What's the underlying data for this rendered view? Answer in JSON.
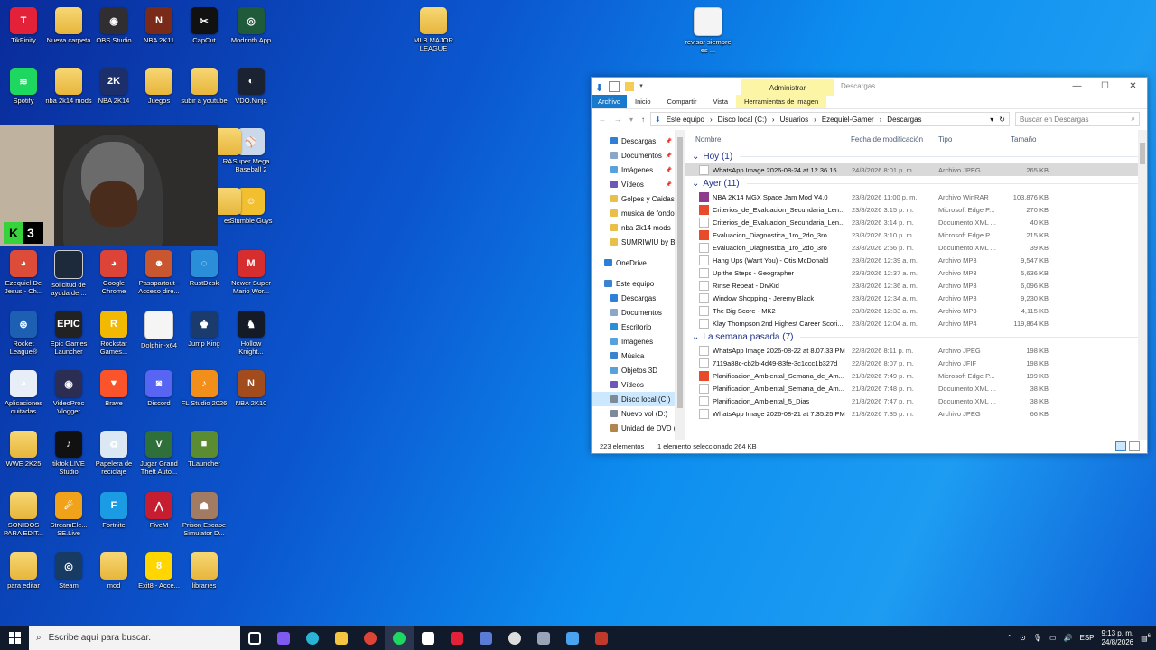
{
  "desktop": {
    "icons": [
      {
        "label": "TikFinity",
        "color": "#e3223a",
        "glyph": "T"
      },
      {
        "label": "Nueva carpeta",
        "color": "folder",
        "glyph": ""
      },
      {
        "label": "OBS Studio",
        "color": "#302e31",
        "glyph": "◉"
      },
      {
        "label": "NBA 2K11",
        "color": "#7a2a18",
        "glyph": "N"
      },
      {
        "label": "CapCut",
        "color": "#111111",
        "glyph": "✂"
      },
      {
        "label": "Modrinth App",
        "color": "#1f5a3a",
        "glyph": "◎"
      },
      {
        "label": "MLB MAJOR LEAGUE",
        "color": "folder",
        "glyph": ""
      },
      {
        "label": "revisar siempre es ...",
        "color": "#f4f4f4",
        "glyph": ""
      },
      {
        "label": "Spotify",
        "color": "#1ed760",
        "glyph": "≋"
      },
      {
        "label": "nba 2k14 mods",
        "color": "folder",
        "glyph": ""
      },
      {
        "label": "NBA 2K14",
        "color": "#1d2f6b",
        "glyph": "2K"
      },
      {
        "label": "Juegos",
        "color": "folder",
        "glyph": ""
      },
      {
        "label": "subir a youtube",
        "color": "folder",
        "glyph": ""
      },
      {
        "label": "VDO.Ninja",
        "color": "#1b2333",
        "glyph": "◐"
      },
      {
        "label": "Super Mega Baseball 2",
        "color": "#c9d8ea",
        "glyph": "⚾"
      },
      {
        "label": "Stumble Guys",
        "color": "#f2c02f",
        "glyph": "☺"
      },
      {
        "label": "Ezequiel De Jesus - Ch...",
        "color": "#dd4b39",
        "glyph": "◕"
      },
      {
        "label": "solicitud de ayuda de ...",
        "color": "#1d2a3c",
        "glyph": ""
      },
      {
        "label": "Google Chrome",
        "color": "#db4437",
        "glyph": "◕"
      },
      {
        "label": "Passpartout - Acceso dire...",
        "color": "#c9562e",
        "glyph": "☻"
      },
      {
        "label": "RustDesk",
        "color": "#2a8ed9",
        "glyph": "◌"
      },
      {
        "label": "Newer Super Mario Wor...",
        "color": "#d62e2e",
        "glyph": "M"
      },
      {
        "label": "Rocket League®",
        "color": "#1c5fb3",
        "glyph": "⊛"
      },
      {
        "label": "Epic Games Launcher",
        "color": "#222222",
        "glyph": "EPIC"
      },
      {
        "label": "Rockstar Games...",
        "color": "#f2b900",
        "glyph": "R"
      },
      {
        "label": "Dolphin-x64",
        "color": "#f5f5f5",
        "glyph": ""
      },
      {
        "label": "Jump King",
        "color": "#1a3b6b",
        "glyph": "♚"
      },
      {
        "label": "Hollow Knight...",
        "color": "#141a26",
        "glyph": "♞"
      },
      {
        "label": "Aplicaciones quitadas",
        "color": "#e8eef7",
        "glyph": "◕"
      },
      {
        "label": "VideoProc Vlogger",
        "color": "#2b2e52",
        "glyph": "◉"
      },
      {
        "label": "Brave",
        "color": "#fb542b",
        "glyph": "▼"
      },
      {
        "label": "Discord",
        "color": "#5865f2",
        "glyph": "◙"
      },
      {
        "label": "FL Studio 2026",
        "color": "#f28f1a",
        "glyph": "♪"
      },
      {
        "label": "NBA 2K10",
        "color": "#a24b1d",
        "glyph": "N"
      },
      {
        "label": "WWE 2K25",
        "color": "folder",
        "glyph": ""
      },
      {
        "label": "tiktok LIVE Studio",
        "color": "#111111",
        "glyph": "♪"
      },
      {
        "label": "Papelera de reciclaje",
        "color": "#dbe8f4",
        "glyph": "♻"
      },
      {
        "label": "Jugar Grand Theft Auto...",
        "color": "#2f6f3a",
        "glyph": "V"
      },
      {
        "label": "TLauncher",
        "color": "#5b8c32",
        "glyph": "■"
      },
      {
        "label": "SONIDOS PARA EDIT...",
        "color": "folder",
        "glyph": ""
      },
      {
        "label": "StreamEle... SE.Live",
        "color": "#f0a31a",
        "glyph": "☄"
      },
      {
        "label": "Fortnite",
        "color": "#1c9be5",
        "glyph": "F"
      },
      {
        "label": "FiveM",
        "color": "#c61d30",
        "glyph": "⋀"
      },
      {
        "label": "Prison Escape Simulator D...",
        "color": "#a27b63",
        "glyph": "☗"
      },
      {
        "label": "para editar",
        "color": "folder",
        "glyph": ""
      },
      {
        "label": "Steam",
        "color": "#173b62",
        "glyph": "◎"
      },
      {
        "label": "mod",
        "color": "folder",
        "glyph": ""
      },
      {
        "label": "Exit8 - Acce...",
        "color": "#ffd600",
        "glyph": "8"
      },
      {
        "label": "librarıes",
        "color": "folder",
        "glyph": ""
      },
      {
        "label": "RA",
        "color": "folder",
        "glyph": ""
      },
      {
        "label": "es",
        "color": "folder",
        "glyph": ""
      }
    ],
    "webcam_badge": "3",
    "webcam_logo": "K"
  },
  "explorer": {
    "context_tab": "Administrar",
    "window_title": "Descargas",
    "ribbon_tabs": [
      "Archivo",
      "Inicio",
      "Compartir",
      "Vista",
      "Herramientas de imagen"
    ],
    "window_buttons": [
      "—",
      "☐",
      "✕"
    ],
    "path": [
      "Este equipo",
      "Disco local (C:)",
      "Usuarios",
      "Ezequiel-Gamer",
      "Descargas"
    ],
    "search_placeholder": "Buscar en Descargas",
    "nav": [
      {
        "label": "Descargas",
        "pin": "📌",
        "color": "#2f7fd9"
      },
      {
        "label": "Documentos",
        "pin": "📌",
        "color": "#8aa7c9"
      },
      {
        "label": "Imágenes",
        "pin": "📌",
        "color": "#5aa0d9"
      },
      {
        "label": "Vídeos",
        "pin": "📌",
        "color": "#6d58b8"
      },
      {
        "label": "Golpes y Caidas",
        "pin": "",
        "color": "#e8bf48"
      },
      {
        "label": "musica de fondo",
        "pin": "",
        "color": "#e8bf48"
      },
      {
        "label": "nba 2k14 mods",
        "pin": "",
        "color": "#e8bf48"
      },
      {
        "label": "SUMRIWIU by BI",
        "pin": "",
        "color": "#e8bf48"
      }
    ],
    "nav2": [
      {
        "label": "OneDrive",
        "color": "#2a7fd6"
      }
    ],
    "nav3": [
      {
        "label": "Este equipo",
        "color": "#3b83cf"
      },
      {
        "label": "Descargas",
        "color": "#2f7fd9"
      },
      {
        "label": "Documentos",
        "color": "#8aa7c9"
      },
      {
        "label": "Escritorio",
        "color": "#2a8ed9"
      },
      {
        "label": "Imágenes",
        "color": "#5aa0d9"
      },
      {
        "label": "Música",
        "color": "#3b83cf"
      },
      {
        "label": "Objetos 3D",
        "color": "#5aa0d9"
      },
      {
        "label": "Vídeos",
        "color": "#6d58b8"
      },
      {
        "label": "Disco local (C:)",
        "color": "#7c8a99"
      },
      {
        "label": "Nuevo vol (D:)",
        "color": "#7c8a99"
      },
      {
        "label": "Unidad de DVD (",
        "color": "#b0864c"
      }
    ],
    "columns": [
      "Nombre",
      "Fecha de modificación",
      "Tipo",
      "Tamaño"
    ],
    "groups": [
      {
        "title": "Hoy (1)",
        "rows": [
          {
            "name": "WhatsApp Image 2026-08-24 at 12.36.15 ...",
            "date": "24/8/2026 8:01 p. m.",
            "type": "Archivo JPEG",
            "size": "265 KB",
            "sel": true
          }
        ]
      },
      {
        "title": "Ayer (11)",
        "rows": [
          {
            "name": "NBA 2K14 MGX Space Jam Mod V4.0",
            "date": "23/8/2026 11:00 p. m.",
            "type": "Archivo WinRAR",
            "size": "103,876 KB"
          },
          {
            "name": "Criterios_de_Evaluacion_Secundaria_Len...",
            "date": "23/8/2026 3:15 p. m.",
            "type": "Microsoft Edge P...",
            "size": "270 KB"
          },
          {
            "name": "Criterios_de_Evaluacion_Secundaria_Len...",
            "date": "23/8/2026 3:14 p. m.",
            "type": "Documento XML ...",
            "size": "40 KB"
          },
          {
            "name": "Evaluacion_Diagnostica_1ro_2do_3ro",
            "date": "23/8/2026 3:10 p. m.",
            "type": "Microsoft Edge P...",
            "size": "215 KB"
          },
          {
            "name": "Evaluacion_Diagnostica_1ro_2do_3ro",
            "date": "23/8/2026 2:56 p. m.",
            "type": "Documento XML ...",
            "size": "39 KB"
          },
          {
            "name": "Hang Ups (Want You) - Otis McDonald",
            "date": "23/8/2026 12:39 a. m.",
            "type": "Archivo MP3",
            "size": "9,547 KB"
          },
          {
            "name": "Up the Steps - Geographer",
            "date": "23/8/2026 12:37 a. m.",
            "type": "Archivo MP3",
            "size": "5,636 KB"
          },
          {
            "name": "Rinse Repeat - DivKid",
            "date": "23/8/2026 12:36 a. m.",
            "type": "Archivo MP3",
            "size": "6,096 KB"
          },
          {
            "name": "Window Shopping - Jeremy Black",
            "date": "23/8/2026 12:34 a. m.",
            "type": "Archivo MP3",
            "size": "9,230 KB"
          },
          {
            "name": "The Big Score - MK2",
            "date": "23/8/2026 12:33 a. m.",
            "type": "Archivo MP3",
            "size": "4,115 KB"
          },
          {
            "name": "Klay Thompson 2nd Highest Career Scori...",
            "date": "23/8/2026 12:04 a. m.",
            "type": "Archivo MP4",
            "size": "119,864 KB"
          }
        ]
      },
      {
        "title": "La semana pasada (7)",
        "rows": [
          {
            "name": "WhatsApp Image 2026-08-22 at 8.07.33 PM",
            "date": "22/8/2026 8:11 p. m.",
            "type": "Archivo JPEG",
            "size": "198 KB"
          },
          {
            "name": "7119a88c-cb2b-4d49-83fe-3c1ccc1b327d",
            "date": "22/8/2026 8:07 p. m.",
            "type": "Archivo JFIF",
            "size": "198 KB"
          },
          {
            "name": "Planificacion_Ambiental_Semana_de_Am...",
            "date": "21/8/2026 7:49 p. m.",
            "type": "Microsoft Edge P...",
            "size": "199 KB"
          },
          {
            "name": "Planificacion_Ambiental_Semana_de_Am...",
            "date": "21/8/2026 7:48 p. m.",
            "type": "Documento XML ...",
            "size": "38 KB"
          },
          {
            "name": "Planificacion_Ambiental_5_Dias",
            "date": "21/8/2026 7:47 p. m.",
            "type": "Documento XML ...",
            "size": "38 KB"
          },
          {
            "name": "WhatsApp Image 2026-08-21 at 7.35.25 PM",
            "date": "21/8/2026 7:35 p. m.",
            "type": "Archivo JPEG",
            "size": "66 KB"
          }
        ]
      }
    ],
    "status_count": "223 elementos",
    "status_selected": "1 elemento seleccionado  264 KB"
  },
  "taskbar": {
    "search_placeholder": "Escribe aquí para buscar.",
    "apps": [
      {
        "name": "task-view",
        "color": "#ffffff"
      },
      {
        "name": "copilot",
        "color": "#7f5af0"
      },
      {
        "name": "edge",
        "color": "#2bb3d6"
      },
      {
        "name": "file-explorer",
        "color": "#f5c542"
      },
      {
        "name": "chrome",
        "color": "#db4437"
      },
      {
        "name": "spotify",
        "color": "#1ed760"
      },
      {
        "name": "notepad",
        "color": "#ffffff"
      },
      {
        "name": "tikfinity",
        "color": "#e3223a"
      },
      {
        "name": "app-blue",
        "color": "#5b7cd6"
      },
      {
        "name": "obs",
        "color": "#dddddd"
      },
      {
        "name": "audio-app",
        "color": "#9aa4b8"
      },
      {
        "name": "dolphin",
        "color": "#4aa3f0"
      },
      {
        "name": "game-app",
        "color": "#c0392b"
      }
    ],
    "language": "ESP",
    "time": "9:13 p. m.",
    "date": "24/8/2026",
    "notification_count": "6"
  }
}
